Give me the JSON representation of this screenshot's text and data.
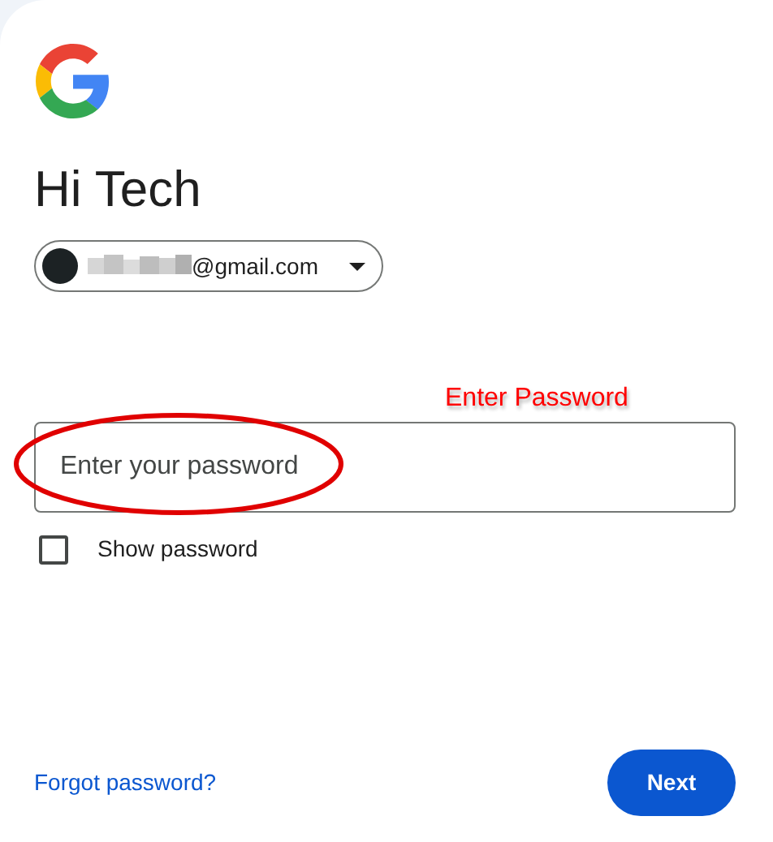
{
  "title": "Hi Tech",
  "account": {
    "email": "@gmail.com"
  },
  "annotation": {
    "text": "Enter Password"
  },
  "password": {
    "placeholder": "Enter your password"
  },
  "show_password": {
    "label": "Show password",
    "checked": false
  },
  "forgot_link": "Forgot password?",
  "next_button": "Next"
}
